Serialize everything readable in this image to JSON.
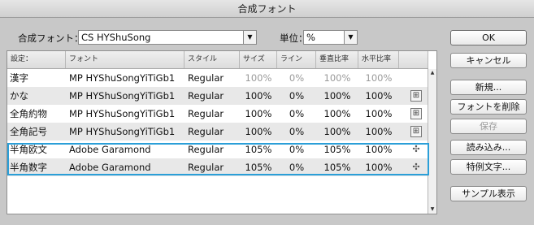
{
  "window": {
    "title": "合成フォント"
  },
  "controls": {
    "font_label": "合成フォント：",
    "font_value": "CS HYShuSong",
    "unit_label": "単位：",
    "unit_value": "%"
  },
  "table": {
    "columns": [
      "設定：",
      "フォント",
      "スタイル",
      "サイズ",
      "ライン",
      "垂直比率",
      "水平比率"
    ],
    "rows": [
      {
        "setting": "漢字",
        "font": "MP HYShuSongYiTiGb1",
        "style": "Regular",
        "size": "100%",
        "line": "0%",
        "vscale": "100%",
        "hscale": "100%",
        "dimmed": true,
        "icon": "none"
      },
      {
        "setting": "かな",
        "font": "MP HYShuSongYiTiGb1",
        "style": "Regular",
        "size": "100%",
        "line": "0%",
        "vscale": "100%",
        "hscale": "100%",
        "dimmed": false,
        "icon": "grid"
      },
      {
        "setting": "全角約物",
        "font": "MP HYShuSongYiTiGb1",
        "style": "Regular",
        "size": "100%",
        "line": "0%",
        "vscale": "100%",
        "hscale": "100%",
        "dimmed": false,
        "icon": "grid"
      },
      {
        "setting": "全角記号",
        "font": "MP HYShuSongYiTiGb1",
        "style": "Regular",
        "size": "100%",
        "line": "0%",
        "vscale": "100%",
        "hscale": "100%",
        "dimmed": false,
        "icon": "grid"
      },
      {
        "setting": "半角欧文",
        "font": "Adobe Garamond",
        "style": "Regular",
        "size": "105%",
        "line": "0%",
        "vscale": "105%",
        "hscale": "100%",
        "dimmed": false,
        "icon": "move"
      },
      {
        "setting": "半角数字",
        "font": "Adobe Garamond",
        "style": "Regular",
        "size": "105%",
        "line": "0%",
        "vscale": "105%",
        "hscale": "100%",
        "dimmed": false,
        "icon": "move"
      }
    ]
  },
  "buttons": {
    "ok": "OK",
    "cancel": "キャンセル",
    "new": "新規...",
    "delete": "フォントを削除",
    "save": "保存",
    "load": "読み込み...",
    "exceptions": "特例文字...",
    "sample": "サンプル表示"
  },
  "colors": {
    "highlight": "#2b9fd8",
    "dimmed_text": "#9a9a9a"
  }
}
